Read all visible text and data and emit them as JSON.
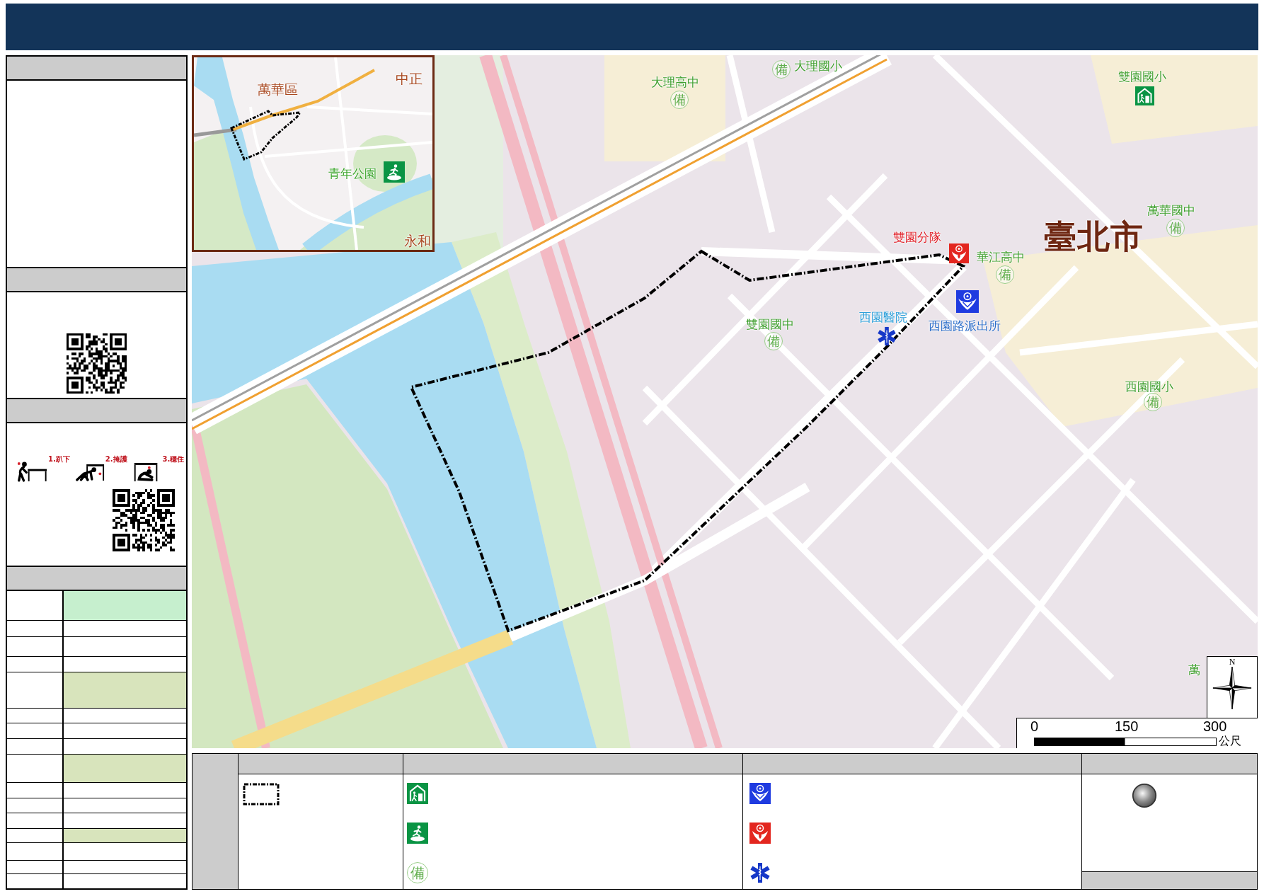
{
  "sidebar": {
    "sections": [
      {
        "kind": "blank"
      },
      {
        "kind": "qr"
      },
      {
        "kind": "quake",
        "steps": [
          {
            "kind": "drop",
            "label": "1.趴下"
          },
          {
            "kind": "cover",
            "label": "2.掩護"
          },
          {
            "kind": "hold",
            "label": "3.穩住"
          }
        ]
      },
      {
        "kind": "table",
        "rows": [
          {
            "color": "#c6efce"
          },
          {
            "color": "#ffffff"
          },
          {
            "color": "#ffffff"
          },
          {
            "color": "#ffffff"
          },
          {
            "color": "#d8e4bc"
          },
          {
            "color": "#ffffff"
          },
          {
            "color": "#ffffff"
          },
          {
            "color": "#ffffff"
          },
          {
            "color": "#d8e4bc"
          },
          {
            "color": "#ffffff"
          },
          {
            "color": "#ffffff"
          },
          {
            "color": "#ffffff"
          },
          {
            "color": "#d8e4bc"
          },
          {
            "color": "#ffffff"
          },
          {
            "color": "#ffffff"
          },
          {
            "color": "#ffffff"
          }
        ]
      }
    ]
  },
  "map": {
    "labels": [
      {
        "text": "大理國小",
        "kind": "school"
      },
      {
        "text": "雙園國小",
        "kind": "school"
      },
      {
        "text": "大理高中",
        "kind": "school"
      },
      {
        "text": "萬華國中",
        "kind": "school"
      },
      {
        "text": "雙園分隊",
        "kind": "fire"
      },
      {
        "text": "臺北市",
        "kind": "city"
      },
      {
        "text": "華江高中",
        "kind": "school"
      },
      {
        "text": "西園醫院",
        "kind": "hospital"
      },
      {
        "text": "雙園國中",
        "kind": "school"
      },
      {
        "text": "西園路派出所",
        "kind": "police"
      },
      {
        "text": "西園國小",
        "kind": "school"
      },
      {
        "text": "萬",
        "kind": "school"
      }
    ],
    "markers": [
      {
        "kind": "reserve",
        "symbol": "備"
      },
      {
        "kind": "shelter"
      },
      {
        "kind": "reserve",
        "symbol": "備"
      },
      {
        "kind": "reserve",
        "symbol": "備"
      },
      {
        "kind": "fire"
      },
      {
        "kind": "reserve",
        "symbol": "備"
      },
      {
        "kind": "police"
      },
      {
        "kind": "medical"
      },
      {
        "kind": "reserve",
        "symbol": "備"
      },
      {
        "kind": "reserve",
        "symbol": "備"
      }
    ],
    "inset": {
      "labels": [
        {
          "text": "萬華區",
          "kind": "district"
        },
        {
          "text": "中正",
          "kind": "district"
        },
        {
          "text": "青年公園",
          "kind": "park"
        },
        {
          "text": "永和",
          "kind": "district"
        }
      ],
      "markers": [
        {
          "kind": "park"
        }
      ]
    },
    "scale": {
      "ticks": [
        "0",
        "150",
        "300"
      ],
      "unit": "公尺"
    },
    "north": "N"
  },
  "legend": {
    "columns": [
      {
        "items": [
          {
            "kind": "route"
          }
        ]
      },
      {
        "items": [
          {
            "kind": "shelter"
          },
          {
            "kind": "park"
          },
          {
            "kind": "reserve",
            "symbol": "備"
          }
        ]
      },
      {
        "items": [
          {
            "kind": "police"
          },
          {
            "kind": "fire"
          },
          {
            "kind": "medical"
          }
        ]
      },
      {
        "items": [
          {
            "kind": "marker"
          }
        ]
      }
    ]
  }
}
